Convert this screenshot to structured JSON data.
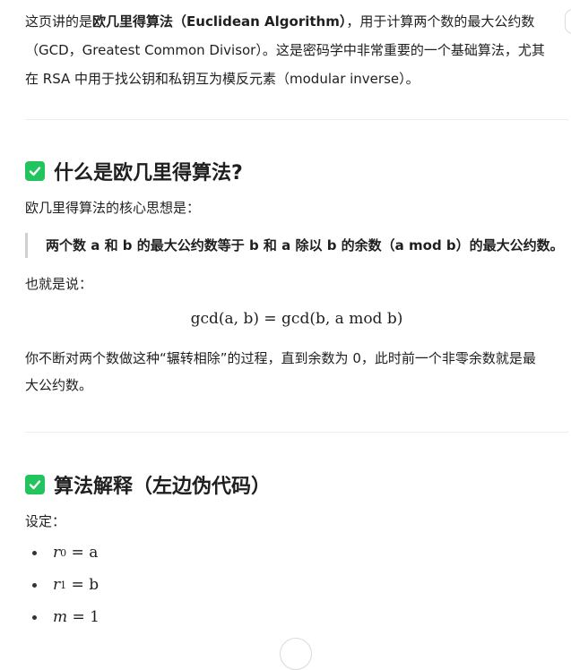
{
  "intro": {
    "line1_prefix": "这页讲的是",
    "line1_bold": "欧几里得算法（Euclidean Algorithm）",
    "line1_suffix": "，用于计算两个数的最大公约数",
    "line2": "（GCD，Greatest Common Divisor）。这是密码学中非常重要的一个基础算法，尤其",
    "line3": "在 RSA 中用于找公钥和私钥互为模反元素（modular inverse）。"
  },
  "section1": {
    "heading": "什么是欧几里得算法?",
    "core_label": "欧几里得算法的核心思想是：",
    "quote": "两个数 a 和 b 的最大公约数等于 b 和 a 除以 b 的余数（a mod b）的最大公约数。",
    "also_label": "也就是说：",
    "formula": "gcd(a, b) = gcd(b, a mod b)",
    "explain_line1": "你不断对两个数做这种“辗转相除”的过程，直到余数为 0，此时前一个非零余数就是最",
    "explain_line2": "大公约数。"
  },
  "section2": {
    "heading": "算法解释（左边伪代码）",
    "setup_label": "设定：",
    "bullets": [
      {
        "var": "r",
        "sub": "0",
        "rhs": "= a"
      },
      {
        "var": "r",
        "sub": "1",
        "rhs": "= b"
      },
      {
        "var": "m",
        "sub": "",
        "rhs": "= 1"
      }
    ]
  },
  "colors": {
    "check_bg": "#21c45d",
    "text": "#1f1f1f"
  },
  "icons": {
    "section_marker": "check-box-icon"
  }
}
